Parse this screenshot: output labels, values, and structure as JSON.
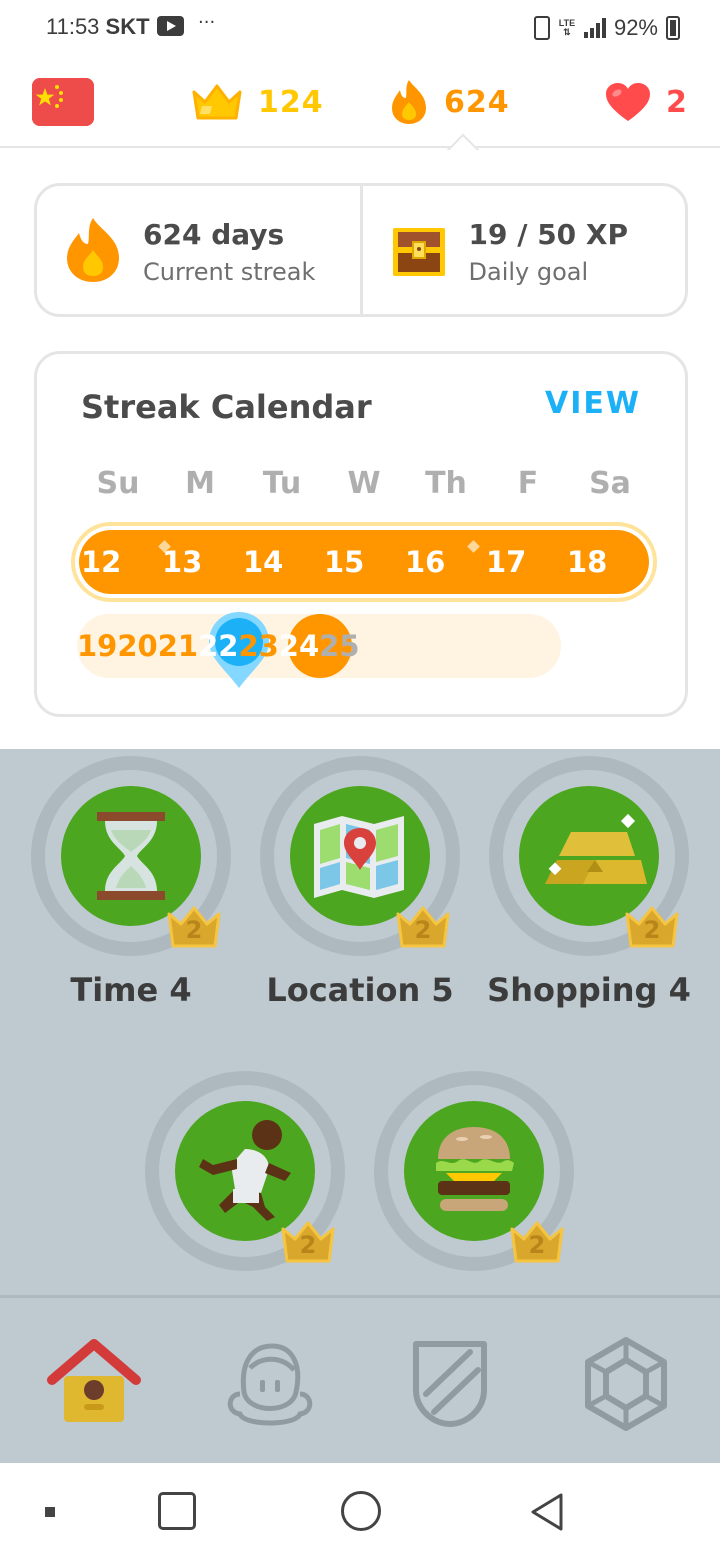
{
  "status_bar": {
    "time": "11:53",
    "carrier": "SKT",
    "dots": "···",
    "battery": "92%"
  },
  "top_bar": {
    "language_flag": "china-flag-icon",
    "crowns": "124",
    "streak": "624",
    "hearts": "2"
  },
  "streak_summary": {
    "streak_value": "624 days",
    "streak_label": "Current streak",
    "xp_value": "19 / 50 XP",
    "xp_label": "Daily goal"
  },
  "calendar": {
    "title": "Streak Calendar",
    "view_label": "VIEW",
    "weekdays": [
      "Su",
      "M",
      "Tu",
      "W",
      "Th",
      "F",
      "Sa"
    ],
    "week1": [
      "12",
      "13",
      "14",
      "15",
      "16",
      "17",
      "18"
    ],
    "week2": [
      "19",
      "20",
      "21",
      "22",
      "23",
      "24",
      "25"
    ],
    "selected_day": "22",
    "today": "24"
  },
  "skills": [
    {
      "label": "Time 4",
      "crown_level": "2",
      "icon": "hourglass-icon"
    },
    {
      "label": "Location 5",
      "crown_level": "2",
      "icon": "map-icon"
    },
    {
      "label": "Shopping 4",
      "crown_level": "2",
      "icon": "gold-bars-icon"
    },
    {
      "label": "",
      "crown_level": "2",
      "icon": "running-person-icon"
    },
    {
      "label": "",
      "crown_level": "2",
      "icon": "burger-icon"
    }
  ],
  "tabs": [
    {
      "name": "learn",
      "icon": "home-icon",
      "active": true
    },
    {
      "name": "profile",
      "icon": "profile-icon",
      "active": false
    },
    {
      "name": "leagues",
      "icon": "shield-icon",
      "active": false
    },
    {
      "name": "shop",
      "icon": "hexagon-icon",
      "active": false
    }
  ],
  "colors": {
    "streak_orange": "#ff9600",
    "crown_gold": "#ffc800",
    "heart_red": "#ff4b4b",
    "link_blue": "#1cb0f6",
    "skill_green": "#4da61f",
    "path_background": "#bec9d0"
  }
}
